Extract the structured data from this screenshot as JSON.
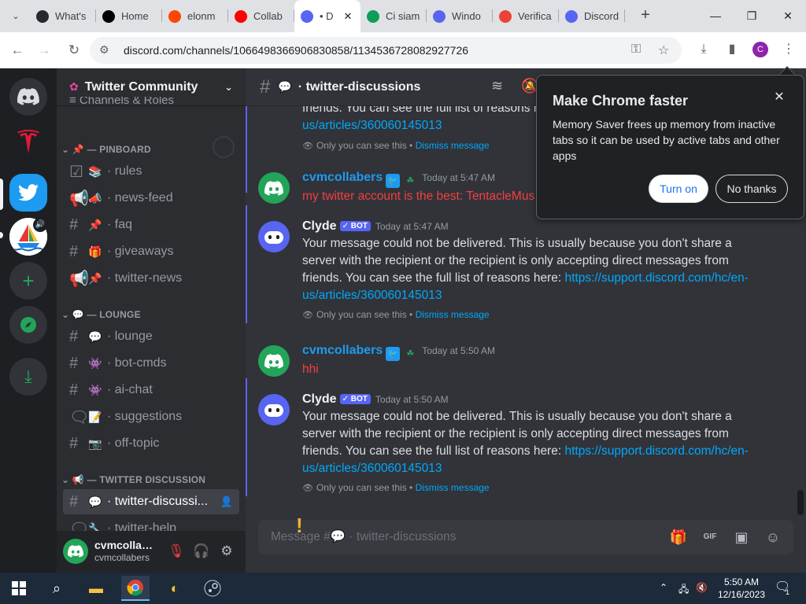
{
  "browser": {
    "tabs": [
      {
        "label": "What's",
        "icon": "github-icon",
        "color": "#24292f",
        "active": false
      },
      {
        "label": "Home",
        "icon": "x-icon",
        "color": "#000000",
        "active": false
      },
      {
        "label": "elonm",
        "icon": "reddit-icon",
        "color": "#ff4500",
        "active": false
      },
      {
        "label": "Collab",
        "icon": "youtube-icon",
        "color": "#ff0000",
        "active": false
      },
      {
        "label": "• D",
        "icon": "discord-icon",
        "color": "#5865f2",
        "active": true
      },
      {
        "label": "Ci siam",
        "icon": "sheets-icon",
        "color": "#0f9d58",
        "active": false
      },
      {
        "label": "Windo",
        "icon": "bug-icon",
        "color": "#5865f2",
        "active": false
      },
      {
        "label": "Verifica",
        "icon": "gmail-icon",
        "color": "#ea4335",
        "active": false
      },
      {
        "label": "Discord",
        "icon": "discord-icon",
        "color": "#5865f2",
        "active": false
      }
    ],
    "url": "discord.com/channels/1066498366906830858/1134536728082927726",
    "profile_initial": "C"
  },
  "popup": {
    "title": "Make Chrome faster",
    "text": "Memory Saver frees up memory from inactive tabs so it can be used by active tabs and other apps",
    "turn_on": "Turn on",
    "no_thanks": "No thanks"
  },
  "server": {
    "name": "Twitter Community",
    "partial_item": "Channels & Roles"
  },
  "categories": {
    "pinboard": "— PINBOARD",
    "lounge": "— LOUNGE",
    "twitter_discussion": "— TWITTER DISCUSSION"
  },
  "channels": {
    "rules": "· rules",
    "news_feed": "· news-feed",
    "faq": "· faq",
    "giveaways": "· giveaways",
    "twitter_news": "· twitter-news",
    "lounge": "· lounge",
    "bot_cmds": "· bot-cmds",
    "ai_chat": "· ai-chat",
    "suggestions": "· suggestions",
    "off_topic": "· off-topic",
    "twitter_discussions": "· twitter-discussi...",
    "twitter_help": "· twitter-help"
  },
  "user": {
    "name": "cvmcollab...",
    "sub": "cvmcollabers"
  },
  "chat": {
    "channel_title": "· twitter-discussions",
    "composer_placeholder": "Message #💬 · twitter-discussions",
    "bot_tag": "✓ BOT",
    "ephemeral_note": "Only you can see this",
    "dismiss": "Dismiss message",
    "sep": " • ",
    "top_partial": {
      "line1": "friends. You can see the full list of reasons h",
      "link": "us/articles/360060145013"
    },
    "messages": [
      {
        "author": "cvmcollabers",
        "time": "Today at 5:47 AM",
        "text": "my twitter account is  the best: TentacleMus"
      },
      {
        "author": "Clyde",
        "time": "Today at 5:47 AM",
        "text": "Your message could not be delivered. This is usually because you don't share a server with the recipient or the recipient is only accepting direct messages from friends. You can see the full list of reasons here: ",
        "link": "https://support.discord.com/hc/en-us/articles/360060145013"
      },
      {
        "author": "cvmcollabers",
        "time": "Today at 5:50 AM",
        "text": "hhi"
      },
      {
        "author": "Clyde",
        "time": "Today at 5:50 AM",
        "text": "Your message could not be delivered. This is usually because you don't share a server with the recipient or the recipient is only accepting direct messages from friends. You can see the full list of reasons here: ",
        "link": "https://support.discord.com/hc/en-us/articles/360060145013"
      }
    ]
  },
  "taskbar": {
    "time": "5:50 AM",
    "date": "12/16/2023",
    "notif_count": "1"
  },
  "colors": {
    "discord_blurple": "#5865f2",
    "link": "#00a8fc",
    "error_red": "#f23f43",
    "online_green": "#23a559"
  }
}
